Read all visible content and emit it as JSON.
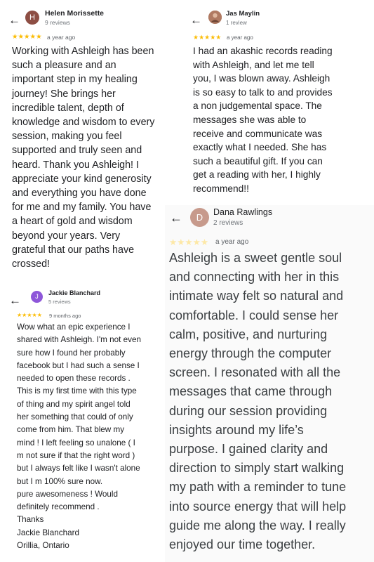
{
  "reviews": [
    {
      "name": "Helen Morissette",
      "count": "9 reviews",
      "initial": "H",
      "stars": "★★★★★",
      "ago": "a year ago",
      "text": "Working with Ashleigh has been\nsuch a pleasure and an\nimportant step in my healing\njourney!  She brings her\nincredible talent, depth of\nknowledge and wisdom to every\nsession, making you feel\nsupported and truly seen and\nheard.  Thank you Ashleigh!  I\nappreciate your kind generosity\nand everything you have done\nfor me and my family.  You have\na heart of gold and wisdom\nbeyond your years.  Very\ngrateful that our paths have\ncrossed!"
    },
    {
      "name": "Jas Maylin",
      "count": "1 review",
      "initial": "",
      "stars": "★★★★★",
      "ago": "a year ago",
      "text": "I had an akashic records reading\nwith Ashleigh, and let me tell\nyou, I was blown away. Ashleigh\nis so easy to talk to and provides\na non judgemental space.  The\nmessages she was able to\nreceive and communicate was\nexactly what I needed. She has\nsuch a beautiful gift. If you can\nget a reading with her, I highly\nrecommend!!"
    },
    {
      "name": "Jackie Blanchard",
      "count": "5 reviews",
      "initial": "J",
      "stars": "★★★★★",
      "ago": "9 months ago",
      "text": "Wow what an epic experience I\nshared with Ashleigh. I'm not even\nsure how I found her probably\nfacebook but I had such a sense I\nneeded to open these records  .\nThis is my first time with this type\nof thing and my spirit angel told\nher something that could of only\ncome from him. That blew my\nmind ! I left feeling so unalone ( I\nm not sure if that the right word )\nbut I always felt like I wasn't alone\nbut I m 100% sure now.\npure awesomeness ! Would\ndefinitely recommend .\nThanks\nJackie Blanchard\nOrillia, Ontario"
    },
    {
      "name": "Dana Rawlings",
      "count": "2 reviews",
      "initial": "D",
      "stars": "★★★★★",
      "ago": "a year ago",
      "text": "Ashleigh is a sweet gentle soul\nand connecting with her in this\nintimate way felt so natural and\ncomfortable. I could sense her\ncalm, positive, and nurturing\nenergy through the computer\nscreen. I resonated with all the\nmessages that came through\nduring our session providing\ninsights around my life’s\npurpose. I gained clarity and\ndirection to simply start walking\nmy path with a reminder to tune\ninto source energy that will help\nguide me along the way. I really\nenjoyed our time together."
    }
  ],
  "icons": {
    "back": "arrow-left-icon",
    "star": "star-icon"
  },
  "colors": {
    "star": "#fbbc04",
    "star_faded": "#fde8a6",
    "meta": "#70757a"
  }
}
